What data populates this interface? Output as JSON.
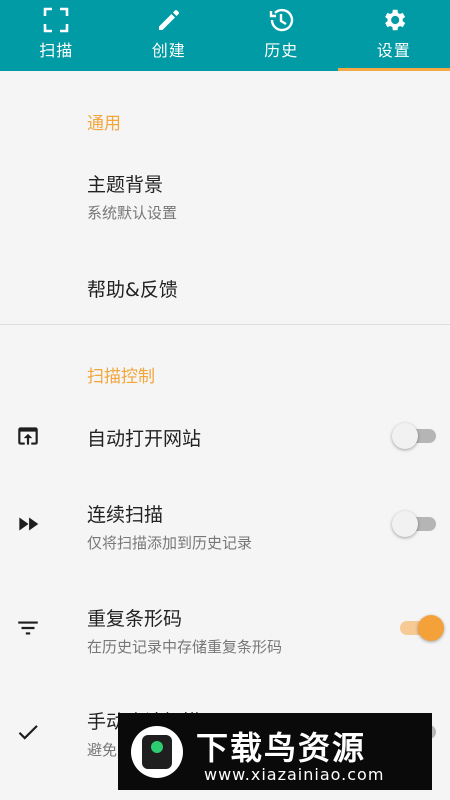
{
  "tabs": [
    {
      "label": "扫描",
      "icon": "scan-frame-icon"
    },
    {
      "label": "创建",
      "icon": "pencil-icon"
    },
    {
      "label": "历史",
      "icon": "history-icon"
    },
    {
      "label": "设置",
      "icon": "gear-icon"
    }
  ],
  "active_tab": "设置",
  "colors": {
    "primary": "#009ba5",
    "accent": "#f5a13a",
    "section": "#f2a63b"
  },
  "general": {
    "title": "通用",
    "theme_title": "主题背景",
    "theme_sub": "系统默认设置",
    "help_title": "帮助&反馈"
  },
  "scan_control": {
    "title": "扫描控制",
    "items": [
      {
        "title": "自动打开网站",
        "sub": "",
        "icon": "open-in-browser-icon",
        "enabled": false
      },
      {
        "title": "连续扫描",
        "sub": "仅将扫描添加到历史记录",
        "icon": "fast-forward-icon",
        "enabled": false
      },
      {
        "title": "重复条形码",
        "sub": "在历史记录中存储重复条形码",
        "icon": "filter-lines-icon",
        "enabled": true
      },
      {
        "title": "手动确认扫描",
        "sub": "避免",
        "icon": "check-icon",
        "enabled": false
      }
    ]
  },
  "watermark": {
    "name": "下载鸟资源",
    "url": "www.xiazainiao.com"
  }
}
